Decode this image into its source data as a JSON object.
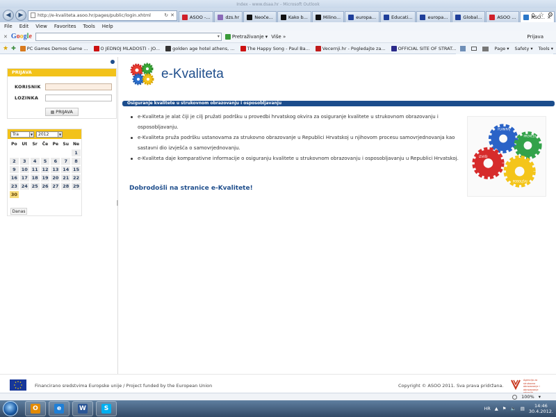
{
  "browser": {
    "window_title": "Index - www.dsaa.hr - Microsoft Outlook",
    "address": "http://e-kvaliteta.asoo.hr/pages/public/login.xhtml",
    "tabs": [
      {
        "label": "ASOO -...",
        "color": "#d0202a"
      },
      {
        "label": "dzs.hr",
        "color": "#8a6ab8"
      },
      {
        "label": "Neoče...",
        "color": "#111111"
      },
      {
        "label": "Kako b...",
        "color": "#111111"
      },
      {
        "label": "Milino...",
        "color": "#111111"
      },
      {
        "label": "europa...",
        "color": "#1f3f9a"
      },
      {
        "label": "Educati...",
        "color": "#1f3f9a"
      },
      {
        "label": "europa...",
        "color": "#1f3f9a"
      },
      {
        "label": "Global...",
        "color": "#1f3f9a"
      },
      {
        "label": "ASOO ...",
        "color": "#d0202a"
      },
      {
        "label": "ASO...",
        "color": "#2b78c9"
      }
    ],
    "menu": [
      "File",
      "Edit",
      "View",
      "Favorites",
      "Tools",
      "Help"
    ],
    "google": {
      "logo": "Google",
      "search_button": "Pretraživanje",
      "more": "Više »",
      "signin": "Prijava"
    },
    "favorites": [
      {
        "label": "PC Games Demos  Game ...",
        "color": "#d87a1e"
      },
      {
        "label": "O JEDNOJ MLADOSTI - JO...",
        "color": "#cc1111"
      },
      {
        "label": "golden age hotel athens, ...",
        "color": "#333333"
      },
      {
        "label": "The Happy Song - Paul Ba...",
        "color": "#cc1111"
      },
      {
        "label": "Vecernji.hr - Pogledajte za...",
        "color": "#c01b1b"
      },
      {
        "label": "OFFICIAL SITE OF STRAT...",
        "color": "#2a2a8a"
      }
    ],
    "toolbar_right": [
      "Page ▾",
      "Safety ▾",
      "Tools ▾"
    ]
  },
  "sidebar": {
    "login": {
      "header": "PRIJAVA",
      "user_label": "KORISNIK",
      "pass_label": "LOZINKA",
      "button": "PRIJAVA"
    },
    "calendar": {
      "month": "Tra",
      "year": "2012",
      "day_names": [
        "Po",
        "Ut",
        "Sr",
        "Če",
        "Pe",
        "Su",
        "Ne"
      ],
      "weeks": [
        [
          "",
          "",
          "",
          "",
          "",
          "",
          "1"
        ],
        [
          "2",
          "3",
          "4",
          "5",
          "6",
          "7",
          "8"
        ],
        [
          "9",
          "10",
          "11",
          "12",
          "13",
          "14",
          "15"
        ],
        [
          "16",
          "17",
          "18",
          "19",
          "20",
          "21",
          "22"
        ],
        [
          "23",
          "24",
          "25",
          "26",
          "27",
          "28",
          "29"
        ],
        [
          "30",
          "",
          "",
          "",
          "",
          "",
          ""
        ]
      ],
      "today": "30",
      "today_button": "Danas"
    }
  },
  "main": {
    "brand": "e-Kvaliteta",
    "section_title": "Osiguranje kvalitete u strukovnom obrazovanju i osposobljavanju",
    "bullets": [
      "e-Kvaliteta je alat čiji je cilj pružati podršku u provedbi hrvatskog okvira za osiguranje kvalitete u strukovnom obrazovanju i osposobljavanju.",
      "e-Kvaliteta pruža podršku ustanovama za strukovno obrazovanje u Republici Hrvatskoj u njihovom procesu samovrjednovanja kao sastavni dio izvješća o samovrjednovanju.",
      "e-Kvaliteta daje komparativne informacije o osiguranju kvalitete u strukovnom obrazovanju i osposobljavanju u Republici Hrvatskoj."
    ],
    "welcome": "Dobrodošli na stranice e-Kvalitete!",
    "gear_labels": [
      "PLANIRAJ",
      "PROVEDI",
      "IZVRŠI",
      "POBOLJŠAJ"
    ]
  },
  "footer": {
    "left": "Financirano sredstvima Europske unije / Project funded by the European Union",
    "right": "Copyright © ASOO 2011. Sva prava pridržana.",
    "agency_text": "Agencija za strukovno obrazovanje i obrazovanje odraslih"
  },
  "status": {
    "zoom": "100%"
  },
  "taskbar": {
    "apps": [
      {
        "name": "outlook",
        "glyph": "O",
        "color": "#e38a00"
      },
      {
        "name": "internet-explorer",
        "glyph": "e",
        "color": "#1f7fd6"
      },
      {
        "name": "word",
        "glyph": "W",
        "color": "#2b5797"
      },
      {
        "name": "skype",
        "glyph": "S",
        "color": "#00aff0"
      }
    ],
    "lang": "HR",
    "time": "14:46",
    "date": "30.4.2012."
  }
}
